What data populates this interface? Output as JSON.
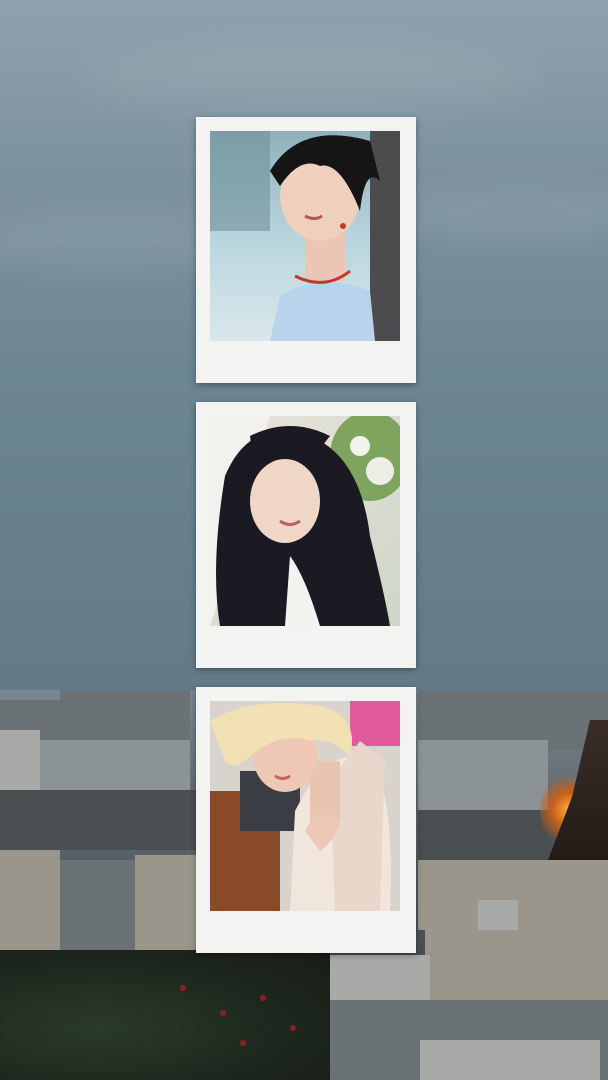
{
  "background": {
    "description_icon": "city-skyline-background",
    "sky_color": "#7c929d",
    "city_color": "#5a6064",
    "glow_color": "#e07a28"
  },
  "polaroids": [
    {
      "photo": "portrait-photo-1"
    },
    {
      "photo": "portrait-photo-2"
    },
    {
      "photo": "portrait-photo-3"
    }
  ],
  "frame_color": "#f3f3f1"
}
